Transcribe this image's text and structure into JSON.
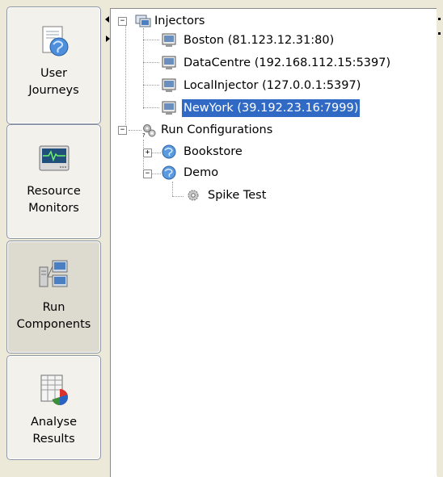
{
  "launcher": {
    "buttons": [
      {
        "id": "user-journeys",
        "line1": "User",
        "line2": "Journeys",
        "icon": "globe-document-icon"
      },
      {
        "id": "resource-monitors",
        "line1": "Resource",
        "line2": "Monitors",
        "icon": "monitor-heartbeat-icon"
      },
      {
        "id": "run-components",
        "line1": "Run",
        "line2": "Components",
        "icon": "servers-network-icon",
        "active": true
      },
      {
        "id": "analyse-results",
        "line1": "Analyse",
        "line2": "Results",
        "icon": "spreadsheet-chart-icon"
      }
    ]
  },
  "tree": {
    "injectors_label": "Injectors",
    "injectors": [
      "Boston (81.123.12.31:80)",
      "DataCentre (192.168.112.15:5397)",
      "LocalInjector (127.0.0.1:5397)",
      "NewYork (39.192.23.16:7999)"
    ],
    "selected_injector_index": 3,
    "run_configurations_label": "Run Configurations",
    "configs": {
      "bookstore": "Bookstore",
      "demo": "Demo",
      "spike_test": "Spike Test"
    }
  },
  "colors": {
    "selection": "#316ac5",
    "background": "#ece9d8"
  }
}
